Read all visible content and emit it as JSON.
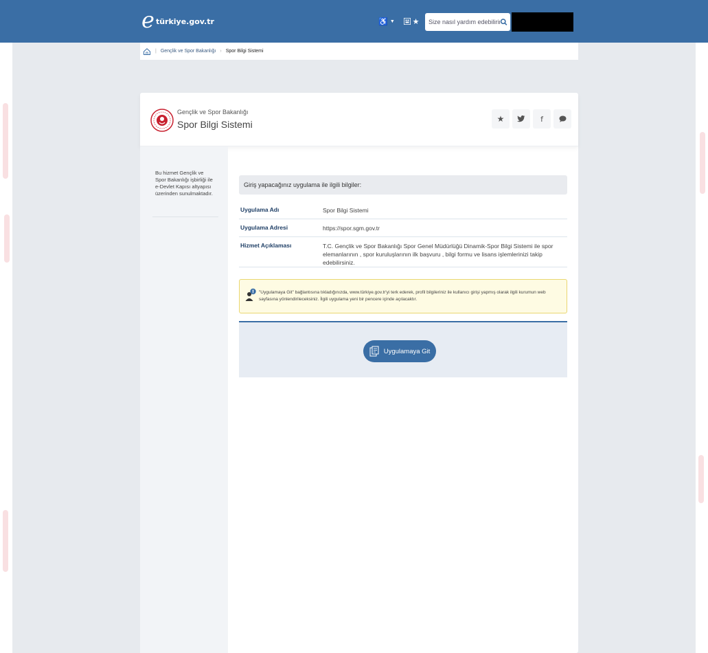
{
  "header": {
    "logo_text": "türkiye.gov.tr",
    "search_placeholder": "Size nasıl yardım edebilirim?"
  },
  "breadcrumb": {
    "items": [
      "Gençlik ve Spor Bakanlığı",
      "Spor Bilgi Sistemi"
    ]
  },
  "service": {
    "org_name": "Gençlik ve Spor Bakanlığı",
    "title": "Spor Bilgi Sistemi"
  },
  "sidebar": {
    "note": "Bu hizmet Gençlik ve Spor Bakanlığı işbirliği ile e-Devlet Kapısı altyapısı üzerinden sunulmaktadır."
  },
  "info": {
    "heading": "Giriş yapacağınız uygulama ile ilgili bilgiler:",
    "rows": [
      {
        "label": "Uygulama Adı",
        "value": "Spor Bilgi Sistemi"
      },
      {
        "label": "Uygulama Adresi",
        "value": "https://spor.sgm.gov.tr"
      },
      {
        "label": "Hizmet Açıklaması",
        "value": "T.C. Gençlik ve Spor Bakanlığı Spor Genel Müdürlüğü Dinamik-Spor Bilgi Sistemi ile spor elemanlarının , spor kuruluşlarının ilk başvuru , bilgi formu ve lisans işlemlerinizi takip edebilirsiniz."
      }
    ]
  },
  "notice": {
    "text": "\"Uygulamaya Git\" bağlantısına tıkladığınızda, www.türkiye.gov.tr'yi terk ederek, profil bilgileriniz ile kullanıcı girişi yapmış olarak ilgili kurumun web sayfasına yönlendirileceksiniz. İlgili uygulama yeni bir pencere içinde açılacaktır."
  },
  "go_button": {
    "label": "Uygulamaya Git"
  },
  "colors": {
    "primary": "#3a6ea5",
    "background": "#e7eaee",
    "notice_bg": "#fefbe3",
    "notice_border": "#e9d670"
  }
}
